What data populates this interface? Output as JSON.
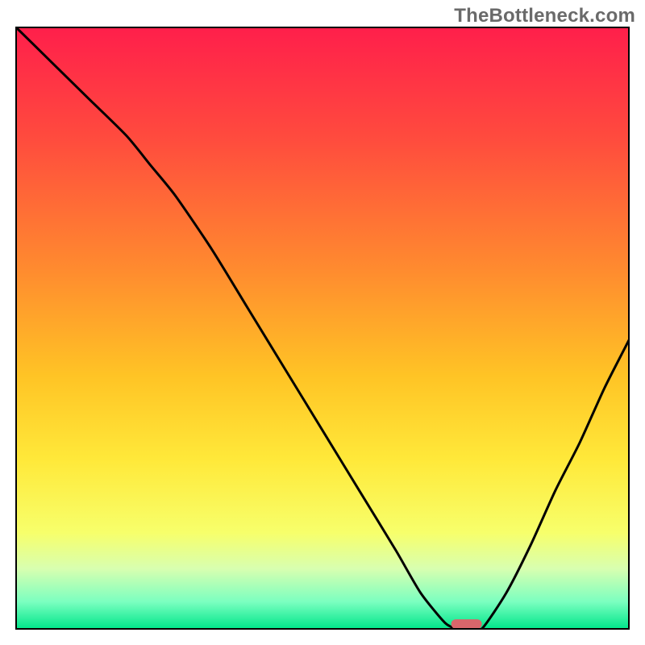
{
  "watermark": "TheBottleneck.com",
  "chart_data": {
    "type": "line",
    "title": "",
    "xlabel": "",
    "ylabel": "",
    "xlim": [
      0,
      100
    ],
    "ylim": [
      0,
      100
    ],
    "gradient_stops": [
      {
        "offset": 0.0,
        "color": "#ff1f4b"
      },
      {
        "offset": 0.18,
        "color": "#ff4a3e"
      },
      {
        "offset": 0.4,
        "color": "#ff8a2f"
      },
      {
        "offset": 0.58,
        "color": "#ffc425"
      },
      {
        "offset": 0.72,
        "color": "#ffe93a"
      },
      {
        "offset": 0.84,
        "color": "#f7ff6b"
      },
      {
        "offset": 0.9,
        "color": "#d8ffb0"
      },
      {
        "offset": 0.955,
        "color": "#7bffc0"
      },
      {
        "offset": 1.0,
        "color": "#00e58a"
      }
    ],
    "series": [
      {
        "name": "bottleneck-curve",
        "color": "#000000",
        "x": [
          0,
          6,
          12,
          18,
          22,
          26,
          32,
          38,
          44,
          50,
          56,
          62,
          66,
          70,
          72,
          74,
          76,
          80,
          84,
          88,
          92,
          96,
          100
        ],
        "y": [
          100,
          94,
          88,
          82,
          77,
          72,
          63,
          53,
          43,
          33,
          23,
          13,
          6,
          1,
          0,
          0,
          0,
          6,
          14,
          23,
          31,
          40,
          48
        ]
      }
    ],
    "marker": {
      "name": "optimal-range-marker",
      "x": 73.5,
      "y": 0,
      "width": 5,
      "height": 1.6,
      "color": "#d9666b"
    },
    "axes": {
      "show_border": true,
      "border_color": "#000000",
      "border_width": 2
    }
  }
}
